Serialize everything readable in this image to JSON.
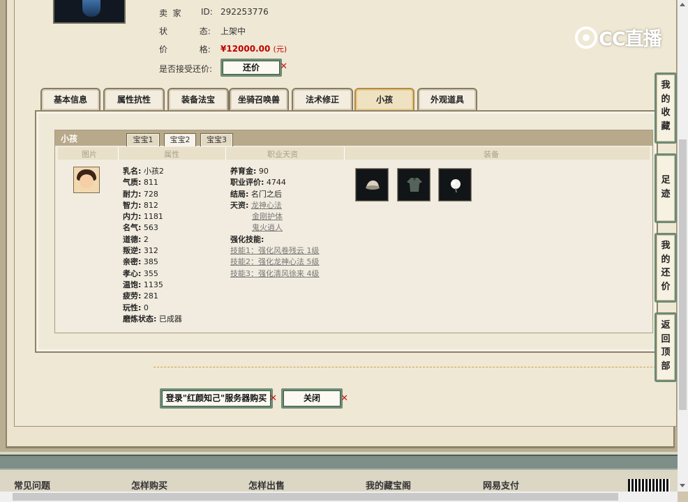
{
  "seller": {
    "label": "卖  家",
    "id_label": "ID:",
    "id_value": "292253776",
    "status_label": "状            态:",
    "status_value": "上架中",
    "price_label": "价            格:",
    "price_value": "¥12000.00",
    "price_unit": "(元)",
    "bargain_label": "是否接受还价:",
    "bargain_button": "还价"
  },
  "logo": {
    "text": "CC直播"
  },
  "tabs": [
    {
      "label": "基本信息"
    },
    {
      "label": "属性抗性"
    },
    {
      "label": "装备法宝"
    },
    {
      "label": "坐骑召唤兽"
    },
    {
      "label": "法术修正"
    },
    {
      "label": "小孩",
      "active": true
    },
    {
      "label": "外观道具"
    }
  ],
  "child_panel": {
    "title": "小孩",
    "subtabs": [
      {
        "label": "宝宝1"
      },
      {
        "label": "宝宝2",
        "active": true
      },
      {
        "label": "宝宝3"
      }
    ],
    "columns": [
      "图片",
      "属性",
      "职业天资",
      "装备"
    ]
  },
  "attributes": [
    {
      "k": "乳名:",
      "v": "小孩2"
    },
    {
      "k": "气质:",
      "v": "811"
    },
    {
      "k": "耐力:",
      "v": "728"
    },
    {
      "k": "智力:",
      "v": "812"
    },
    {
      "k": "内力:",
      "v": "1181"
    },
    {
      "k": "名气:",
      "v": "563"
    },
    {
      "k": "道德:",
      "v": "2"
    },
    {
      "k": "叛逆:",
      "v": "312"
    },
    {
      "k": "亲密:",
      "v": "385"
    },
    {
      "k": "孝心:",
      "v": "355"
    },
    {
      "k": "温饱:",
      "v": "1135"
    },
    {
      "k": "疲劳:",
      "v": "281"
    },
    {
      "k": "玩性:",
      "v": "0"
    },
    {
      "k": "磨炼状态:",
      "v": "已成器"
    }
  ],
  "career": {
    "fund_k": "养育金:",
    "fund_v": "90",
    "score_k": "职业评价:",
    "score_v": "4744",
    "ending_k": "结局:",
    "ending_v": "名门之后",
    "talent_k": "天资:",
    "talents": [
      "龙神心法",
      "金刚护体",
      "鬼火逍人"
    ],
    "skills_label": "强化技能:",
    "skills": [
      "技能1：强化风卷残云 1级",
      "技能2：强化龙神心法 5级",
      "技能3：强化清风徐来 4级"
    ]
  },
  "equipment": [
    "hat-icon",
    "robe-icon",
    "flower-icon"
  ],
  "buttons": {
    "login_buy": "登录\"红颜知己\"服务器购买",
    "close": "关闭"
  },
  "side_buttons": [
    {
      "label": "我的收藏",
      "chars": [
        "我",
        "的",
        "收",
        "藏"
      ]
    },
    {
      "label": "足迹",
      "chars": [
        "足",
        "迹"
      ]
    },
    {
      "label": "我的还价",
      "chars": [
        "我",
        "的",
        "还",
        "价"
      ]
    },
    {
      "label": "返回顶部",
      "chars": [
        "返",
        "回",
        "顶",
        "部"
      ]
    }
  ],
  "footer": [
    "常见问题",
    "怎样购买",
    "怎样出售",
    "我的藏宝阁",
    "网易支付"
  ],
  "colors": {
    "price": "#c00000",
    "accent_tab": "#b08a48",
    "button_border": "#6e8c76"
  }
}
